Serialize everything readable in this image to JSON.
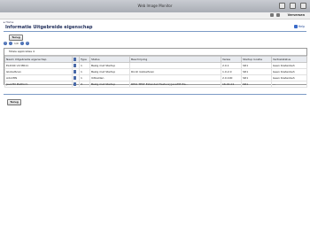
{
  "window": {
    "title": "Web Image Monitor"
  },
  "toolbar": {
    "refresh_label": "Verversen"
  },
  "breadcrumb": {
    "home": "Home"
  },
  "page": {
    "title": "Informatie Uitgebreide eigenschap",
    "help_label": "Help"
  },
  "buttons": {
    "back_label": "Terug"
  },
  "pager": {
    "range": "1/0"
  },
  "table": {
    "total": "Totale applicaties 4",
    "headers": [
      "Naam Uitgebreide eigenschap",
      "",
      "Type",
      "Status",
      "Beschrijving",
      "Versie",
      "Startup locatie",
      "Vertrekstatus"
    ],
    "rows": [
      [
        "ELP-NX V2 MR11",
        "",
        "1",
        "Bezig met Startup",
        "",
        "2.0.1",
        "SD1",
        "Geen Kostenbeh"
      ],
      [
        "GlobalScan",
        "",
        "1",
        "Bezig met Startup",
        "Ricoh GlobalScan",
        "1.0.2.0",
        "SD1",
        "Geen Kostenbeh"
      ],
      [
        "AdoCMS",
        "",
        "1",
        "Uitbalden",
        "",
        "2.0.100",
        "SD1",
        "Geen Kostenbeh"
      ],
      [
        "JavaTM Platform",
        "",
        "3",
        "Bezig met Startup",
        "RHCI TEST Extended Feature] JavaTM Pla...",
        "16.01.01",
        "SD1",
        "---"
      ]
    ]
  }
}
